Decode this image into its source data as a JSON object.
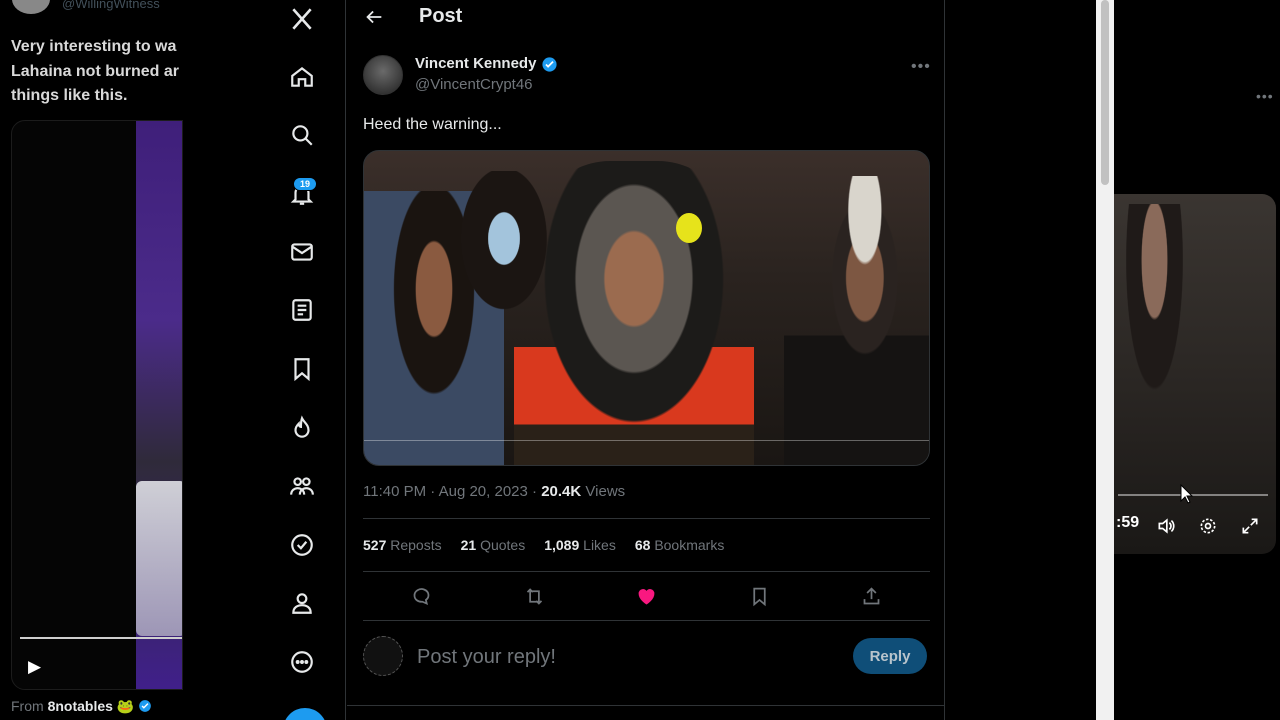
{
  "left_tweet": {
    "handle": "@WillingWitness",
    "text": "Very interesting to wa\nLahaina not burned ar\nthings like this.",
    "from_label": "From",
    "from_name": "8notables 🐸"
  },
  "nav": {
    "items": [
      "x-logo",
      "home-icon",
      "search-icon",
      "notifications-icon",
      "messages-icon",
      "lists-icon",
      "bookmarks-icon",
      "communities-icon",
      "people-icon",
      "verified-icon",
      "profile-icon",
      "more-icon"
    ],
    "notifications_badge": "19"
  },
  "header": {
    "title": "Post"
  },
  "post": {
    "author_name": "Vincent Kennedy",
    "author_handle": "@VincentCrypt46",
    "text": "Heed the warning...",
    "time": "11:40 PM",
    "date": "Aug 20, 2023",
    "views_count": "20.4K",
    "views_label": "Views"
  },
  "stats": [
    {
      "count": "527",
      "label": "Reposts"
    },
    {
      "count": "21",
      "label": "Quotes"
    },
    {
      "count": "1,089",
      "label": "Likes"
    },
    {
      "count": "68",
      "label": "Bookmarks"
    }
  ],
  "reply": {
    "placeholder": "Post your reply!",
    "button_label": "Reply"
  },
  "right_video": {
    "time": ":59"
  },
  "colors": {
    "accent": "#1d9bf0",
    "like": "#f91880",
    "background": "#000000"
  }
}
